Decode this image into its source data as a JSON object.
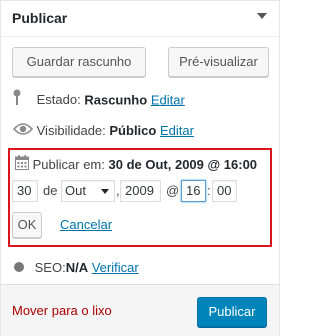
{
  "panel": {
    "title": "Publicar"
  },
  "actions": {
    "save_draft_label": "Guardar rascunho",
    "preview_label": "Pré-visualizar"
  },
  "status": {
    "label": "Estado:",
    "value": "Rascunho",
    "edit_label": "Editar"
  },
  "visibility": {
    "label": "Visibilidade:",
    "value": "Público",
    "edit_label": "Editar"
  },
  "schedule": {
    "label": "Publicar em:",
    "value": "30 de Out, 2009 @ 16:00",
    "day": "30",
    "de_label": "de",
    "month": "Out",
    "comma": ",",
    "year": "2009",
    "at_label": "@",
    "hour": "16",
    "colon": ":",
    "minute": "00",
    "ok_label": "OK",
    "cancel_label": "Cancelar"
  },
  "seo": {
    "label": "SEO:",
    "value": "N/A",
    "verify_label": "Verificar"
  },
  "footer": {
    "trash_label": "Mover para o lixo",
    "publish_label": "Publicar"
  },
  "colors": {
    "link": "#0073aa",
    "primary_button": "#0085ba",
    "highlight_border": "#d9151b",
    "trash": "#aa0000",
    "seo_dot": "#777777"
  },
  "icons": {
    "status": "pin-icon",
    "visibility": "eye-icon",
    "schedule": "calendar-icon",
    "seo": "status-dot-icon",
    "toggle": "collapse-arrow-icon"
  }
}
